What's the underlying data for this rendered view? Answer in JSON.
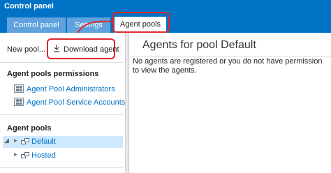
{
  "window": {
    "title": "Control panel"
  },
  "tabs": [
    {
      "label": "Control panel",
      "active": false
    },
    {
      "label": "Settings",
      "active": false
    },
    {
      "label": "Agent pools",
      "active": true
    }
  ],
  "toolbar": {
    "new_pool_label": "New pool...",
    "download_agent_label": "Download agent",
    "download_icon": "download-icon"
  },
  "permissions": {
    "header": "Agent pools permissions",
    "items": [
      {
        "label": "Agent Pool Administrators",
        "icon": "group-icon"
      },
      {
        "label": "Agent Pool Service Accounts",
        "icon": "group-icon"
      }
    ]
  },
  "pools": {
    "header": "Agent pools",
    "items": [
      {
        "label": "Default",
        "selected": true,
        "icon": "pool-icon"
      },
      {
        "label": "Hosted",
        "selected": false,
        "icon": "pool-icon"
      }
    ]
  },
  "main": {
    "title": "Agents for pool Default",
    "empty_message": "No agents are registered or you do not have permission to view the agents."
  },
  "colors": {
    "brand": "#0072c6",
    "inactive_tab": "#5fa2dd",
    "highlight": "#e0262e",
    "selection": "#cde8ff"
  }
}
